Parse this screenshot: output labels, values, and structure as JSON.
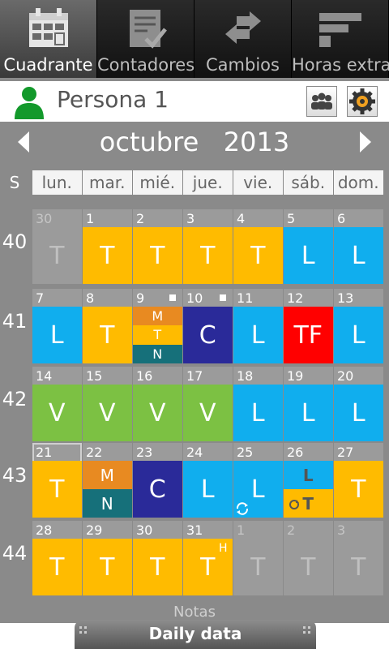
{
  "tabs": [
    {
      "label": "Cuadrante",
      "icon": "calendar-grid-icon",
      "active": true
    },
    {
      "label": "Contadores",
      "icon": "checklist-icon",
      "active": false
    },
    {
      "label": "Cambios",
      "icon": "swap-arrows-icon",
      "active": false
    },
    {
      "label": "Horas extra",
      "icon": "bars-icon",
      "active": false
    }
  ],
  "person": {
    "name": "Persona 1",
    "icon": "person-icon"
  },
  "header_buttons": [
    "group-icon",
    "settings-gear-icon"
  ],
  "month": {
    "name": "octubre",
    "year": "2013",
    "title": "octubre   2013"
  },
  "week_label": "S",
  "weekdays": [
    "lun.",
    "mar.",
    "mié.",
    "jue.",
    "vie.",
    "sáb.",
    "dom."
  ],
  "colors": {
    "T": "#ffbb00",
    "L": "#10aeee",
    "C": "#2a2a99",
    "V": "#7cc143",
    "TF": "#ff0000",
    "M": "#e88a21",
    "N": "#16707a"
  },
  "weeks": [
    {
      "num": "40",
      "days": [
        {
          "d": "30",
          "s": "T",
          "out": true
        },
        {
          "d": "1",
          "s": "T"
        },
        {
          "d": "2",
          "s": "T"
        },
        {
          "d": "3",
          "s": "T"
        },
        {
          "d": "4",
          "s": "T"
        },
        {
          "d": "5",
          "s": "L"
        },
        {
          "d": "6",
          "s": "L"
        }
      ]
    },
    {
      "num": "41",
      "days": [
        {
          "d": "7",
          "s": "L"
        },
        {
          "d": "8",
          "s": "T"
        },
        {
          "d": "9",
          "multi": [
            "M",
            "T",
            "N"
          ],
          "note": true
        },
        {
          "d": "10",
          "s": "C",
          "note": true
        },
        {
          "d": "11",
          "s": "L"
        },
        {
          "d": "12",
          "s": "TF"
        },
        {
          "d": "13",
          "s": "L"
        }
      ]
    },
    {
      "num": "42",
      "days": [
        {
          "d": "14",
          "s": "V"
        },
        {
          "d": "15",
          "s": "V"
        },
        {
          "d": "16",
          "s": "V"
        },
        {
          "d": "17",
          "s": "V"
        },
        {
          "d": "18",
          "s": "L"
        },
        {
          "d": "19",
          "s": "L"
        },
        {
          "d": "20",
          "s": "L"
        }
      ]
    },
    {
      "num": "43",
      "days": [
        {
          "d": "21",
          "s": "T",
          "today": true
        },
        {
          "d": "22",
          "multi": [
            "M",
            "N"
          ]
        },
        {
          "d": "23",
          "s": "C"
        },
        {
          "d": "24",
          "s": "L"
        },
        {
          "d": "25",
          "s": "L",
          "sync": true
        },
        {
          "d": "26",
          "multi": [
            "L",
            "T"
          ],
          "swap": true
        },
        {
          "d": "27",
          "s": "T"
        }
      ]
    },
    {
      "num": "44",
      "days": [
        {
          "d": "28",
          "s": "T"
        },
        {
          "d": "29",
          "s": "T"
        },
        {
          "d": "30",
          "s": "T"
        },
        {
          "d": "31",
          "s": "T",
          "sup": "H"
        },
        {
          "d": "1",
          "s": "T",
          "out": true
        },
        {
          "d": "2",
          "s": "T",
          "out": true
        },
        {
          "d": "3",
          "s": "T",
          "out": true
        }
      ]
    }
  ],
  "notes_label": "Notas",
  "daily_data_label": "Daily data"
}
